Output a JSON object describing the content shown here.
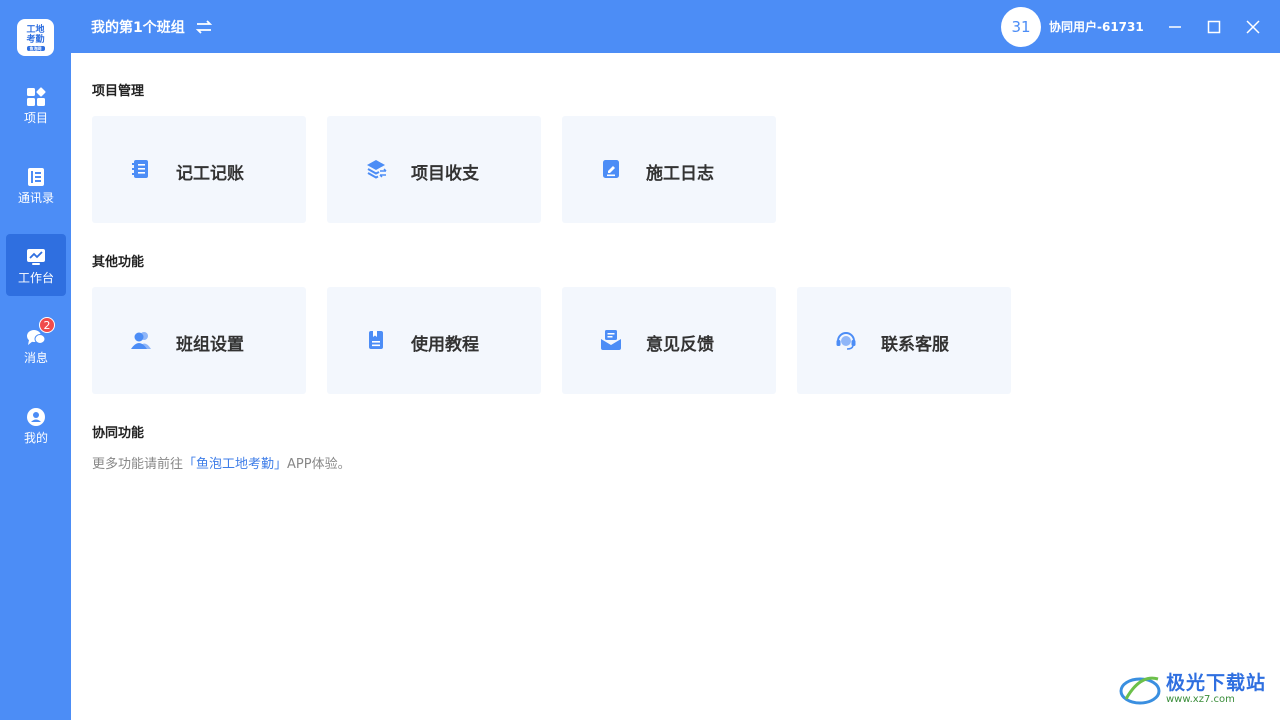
{
  "app": {
    "logo_line1": "工地",
    "logo_line2": "考勤",
    "logo_tag": "鱼泡网"
  },
  "header": {
    "team_name": "我的第1个班组",
    "avatar_text": "31",
    "username": "协同用户-61731"
  },
  "sidebar": {
    "items": [
      {
        "label": "项目",
        "icon": "grid-icon"
      },
      {
        "label": "通讯录",
        "icon": "contacts-icon"
      },
      {
        "label": "工作台",
        "icon": "workbench-icon",
        "active": true
      },
      {
        "label": "消息",
        "icon": "chat-icon",
        "badge": "2"
      },
      {
        "label": "我的",
        "icon": "user-icon"
      }
    ]
  },
  "sections": {
    "project": {
      "title": "项目管理",
      "cards": [
        {
          "label": "记工记账",
          "icon": "notebook-icon"
        },
        {
          "label": "项目收支",
          "icon": "layers-icon"
        },
        {
          "label": "施工日志",
          "icon": "edit-doc-icon"
        }
      ]
    },
    "other": {
      "title": "其他功能",
      "cards": [
        {
          "label": "班组设置",
          "icon": "team-icon"
        },
        {
          "label": "使用教程",
          "icon": "book-icon"
        },
        {
          "label": "意见反馈",
          "icon": "feedback-icon"
        },
        {
          "label": "联系客服",
          "icon": "headset-icon"
        }
      ]
    },
    "collab": {
      "title": "协同功能",
      "text_before": "更多功能请前往",
      "link_text": "「鱼泡工地考勤」",
      "text_after": "APP体验。"
    }
  },
  "watermark": {
    "line1": "极光下载站",
    "line2": "www.xz7.com"
  },
  "colors": {
    "primary": "#4c8df6",
    "active": "#2f6fe0",
    "card_bg": "#f3f7fd",
    "badge": "#f04b4b",
    "link": "#3f7ee8"
  }
}
